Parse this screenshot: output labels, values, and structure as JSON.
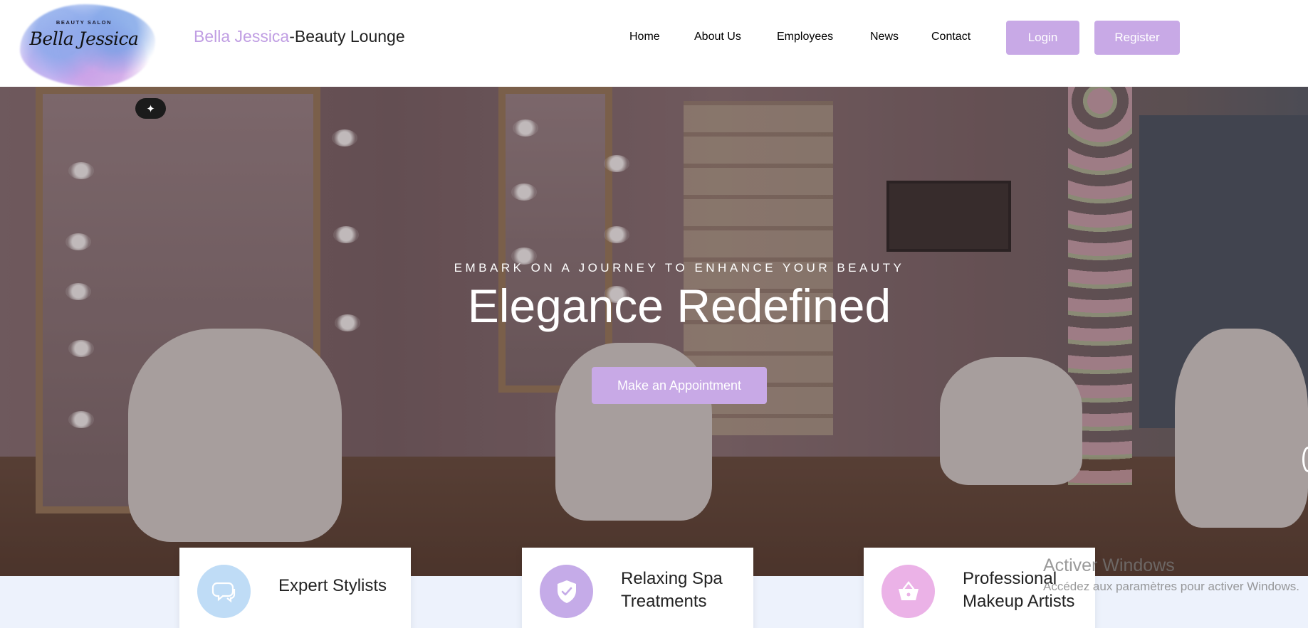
{
  "logo": {
    "small_text": "BEAUTY SALON",
    "script_text": "Bella Jessica"
  },
  "brand": {
    "accent": "Bella Jessica",
    "rest": "-Beauty Lounge"
  },
  "nav": {
    "items": [
      {
        "label": "Home",
        "active": true
      },
      {
        "label": "About Us"
      },
      {
        "label": "Employees"
      },
      {
        "label": "News"
      },
      {
        "label": "Contact"
      }
    ],
    "login": "Login",
    "register": "Register"
  },
  "hero": {
    "subtitle": "EMBARK ON A JOURNEY TO ENHANCE YOUR BEAUTY",
    "title": "Elegance Redefined",
    "cta": "Make an Appointment",
    "tool_icon": "magic-wand-icon"
  },
  "features": [
    {
      "label": "Expert Stylists",
      "icon": "chat-bubbles-icon"
    },
    {
      "label_line1": "Relaxing Spa",
      "label_line2": "Treatments",
      "icon": "shield-check-icon"
    },
    {
      "label_line1": "Professional",
      "label_line2": "Makeup Artists",
      "icon": "basket-icon"
    }
  ],
  "watermark": {
    "title": "Activer Windows",
    "subtitle": "Accédez aux paramètres pour activer Windows."
  },
  "colors": {
    "accent": "#c8a9e6",
    "nav_active": "#b98de0",
    "brand_accent": "#c09ee3",
    "band": "#edf2fc"
  }
}
